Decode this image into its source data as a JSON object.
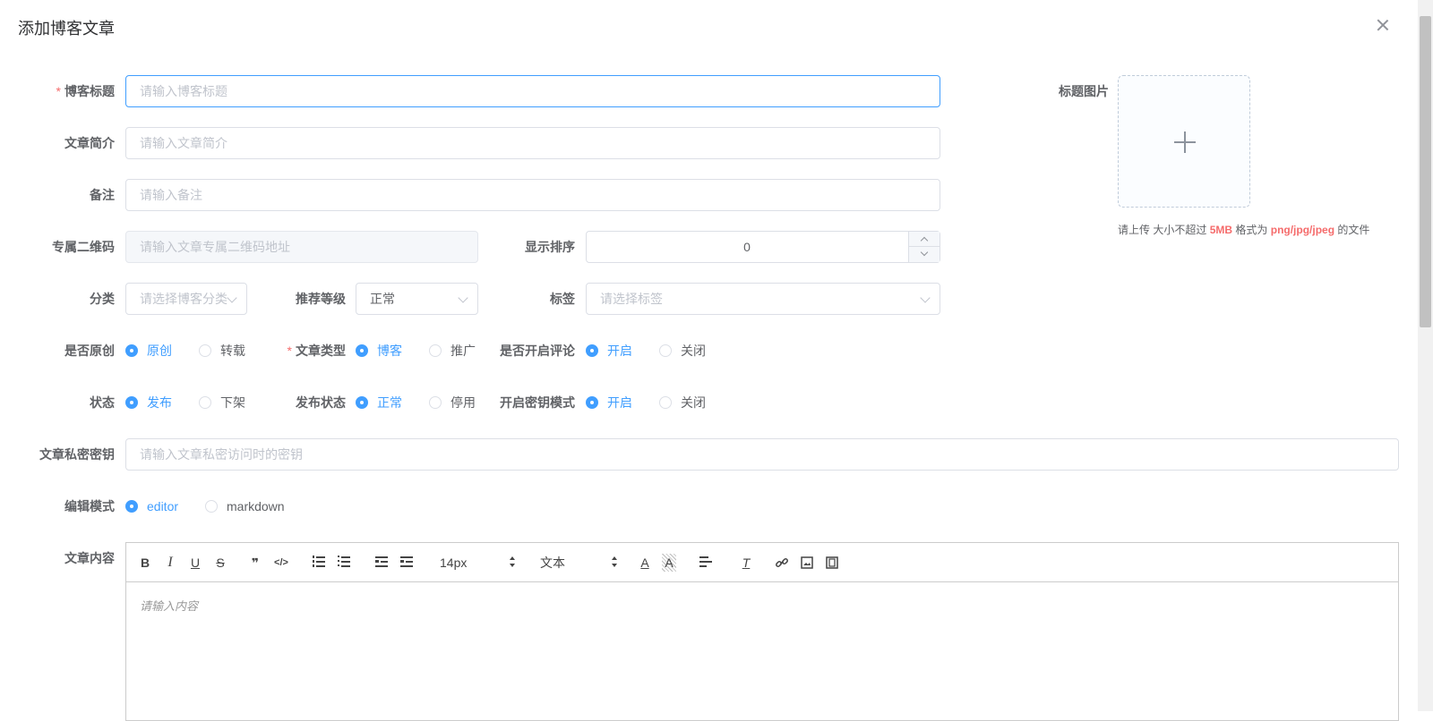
{
  "dialog": {
    "title": "添加博客文章"
  },
  "fields": {
    "title": {
      "label": "博客标题",
      "required_mark": "*",
      "placeholder": "请输入博客标题"
    },
    "summary": {
      "label": "文章简介",
      "placeholder": "请输入文章简介"
    },
    "remark": {
      "label": "备注",
      "placeholder": "请输入备注"
    },
    "qrcode": {
      "label": "专属二维码",
      "placeholder": "请输入文章专属二维码地址"
    },
    "sort": {
      "label": "显示排序",
      "value": "0"
    },
    "category": {
      "label": "分类",
      "placeholder": "请选择博客分类"
    },
    "level": {
      "label": "推荐等级",
      "value": "正常"
    },
    "tags": {
      "label": "标签",
      "placeholder": "请选择标签"
    },
    "original": {
      "label": "是否原创",
      "options": [
        "原创",
        "转载"
      ],
      "selected": "原创"
    },
    "article_type": {
      "label": "文章类型",
      "required_mark": "*",
      "options": [
        "博客",
        "推广"
      ],
      "selected": "博客"
    },
    "comment": {
      "label": "是否开启评论",
      "options": [
        "开启",
        "关闭"
      ],
      "selected": "开启"
    },
    "status": {
      "label": "状态",
      "options": [
        "发布",
        "下架"
      ],
      "selected": "发布"
    },
    "publish_status": {
      "label": "发布状态",
      "options": [
        "正常",
        "停用"
      ],
      "selected": "正常"
    },
    "secret_mode": {
      "label": "开启密钥模式",
      "options": [
        "开启",
        "关闭"
      ],
      "selected": "开启"
    },
    "secret_key": {
      "label": "文章私密密钥",
      "placeholder": "请输入文章私密访问时的密钥"
    },
    "edit_mode": {
      "label": "编辑模式",
      "options": [
        "editor",
        "markdown"
      ],
      "selected": "editor"
    },
    "content": {
      "label": "文章内容",
      "placeholder": "请输入内容"
    }
  },
  "upload": {
    "label": "标题图片",
    "tip_prefix": "请上传 大小不超过",
    "tip_size": "5MB",
    "tip_mid": "格式为",
    "tip_formats": "png/jpg/jpeg",
    "tip_suffix": "的文件"
  },
  "editor_toolbar": {
    "bold": "B",
    "italic": "I",
    "underline": "U",
    "strike": "S",
    "quote": "❞",
    "code": "</>",
    "font_size": "14px",
    "header": "文本",
    "font_color": "A",
    "background": "A",
    "clean": "T"
  },
  "colors": {
    "primary": "#409eff",
    "required": "#f56c6c",
    "border": "#dcdfe6",
    "placeholder": "#c0c4cc"
  },
  "icons": [
    "close-icon",
    "plus-icon",
    "ordered-list-icon",
    "bullet-list-icon",
    "indent-icon",
    "outdent-icon",
    "align-icon",
    "link-icon",
    "image-icon",
    "video-icon"
  ]
}
